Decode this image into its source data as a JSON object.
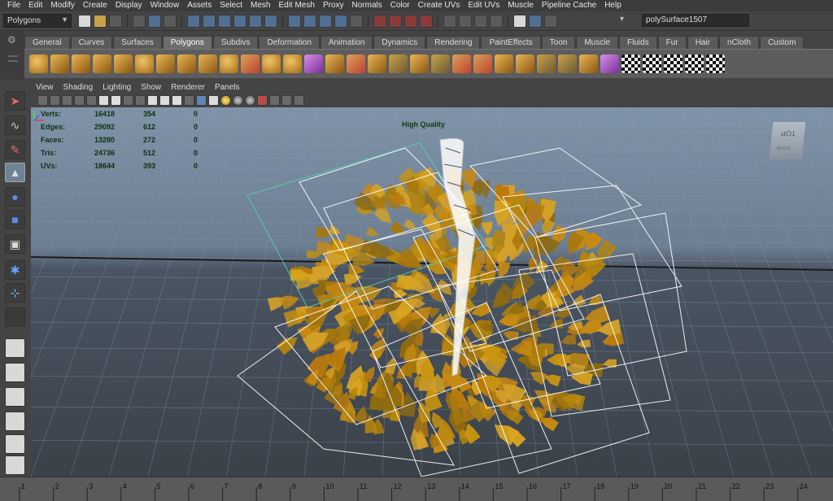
{
  "menubar": [
    "File",
    "Edit",
    "Modify",
    "Create",
    "Display",
    "Window",
    "Assets",
    "Select",
    "Mesh",
    "Edit Mesh",
    "Proxy",
    "Normals",
    "Color",
    "Create UVs",
    "Edit UVs",
    "Muscle",
    "Pipeline Cache",
    "Help"
  ],
  "status": {
    "menuset": "Polygons",
    "object_name": "polySurface1507"
  },
  "shelf_tabs": [
    "General",
    "Curves",
    "Surfaces",
    "Polygons",
    "Subdivs",
    "Deformation",
    "Animation",
    "Dynamics",
    "Rendering",
    "PaintEffects",
    "Toon",
    "Muscle",
    "Fluids",
    "Fur",
    "Hair",
    "nCloth",
    "Custom"
  ],
  "active_shelf": "Polygons",
  "panel_menu": [
    "View",
    "Shading",
    "Lighting",
    "Show",
    "Renderer",
    "Panels"
  ],
  "hud": {
    "rows": [
      {
        "label": "Verts:",
        "a": "16418",
        "b": "354",
        "c": "0"
      },
      {
        "label": "Edges:",
        "a": "29092",
        "b": "612",
        "c": "0"
      },
      {
        "label": "Faces:",
        "a": "13280",
        "b": "272",
        "c": "0"
      },
      {
        "label": "Tris:",
        "a": "24736",
        "b": "512",
        "c": "0"
      },
      {
        "label": "UVs:",
        "a": "18644",
        "b": "393",
        "c": "0"
      }
    ],
    "quality": "High Quality"
  },
  "viewcube": {
    "top": "TOP",
    "back": "BACK"
  },
  "timeline": {
    "ticks": [
      "1",
      "2",
      "3",
      "4",
      "5",
      "6",
      "7",
      "8",
      "9",
      "10",
      "11",
      "12",
      "13",
      "14",
      "15",
      "16",
      "17",
      "18",
      "19",
      "20",
      "21",
      "22",
      "23",
      "24"
    ]
  },
  "colors": {
    "leaf": "#c9940f",
    "hud_text": "#0f2f0f",
    "wire": "#ffffff",
    "selected_box": "#55d0b0"
  }
}
